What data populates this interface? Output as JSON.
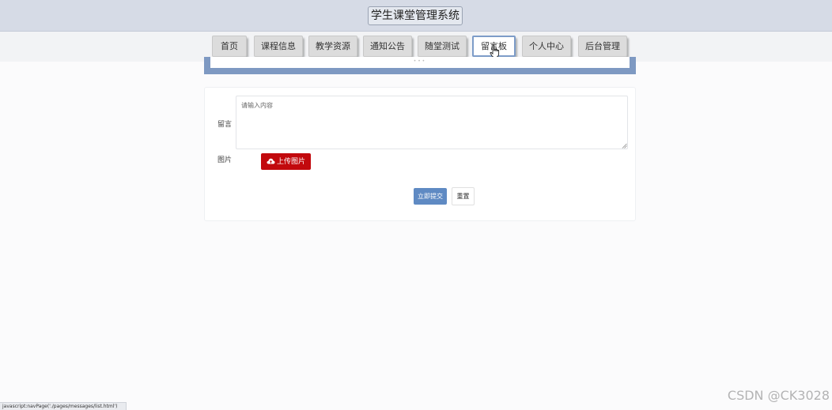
{
  "header": {
    "site_title": "学生课堂管理系统"
  },
  "nav": {
    "items": [
      {
        "label": "首页"
      },
      {
        "label": "课程信息"
      },
      {
        "label": "教学资源"
      },
      {
        "label": "通知公告"
      },
      {
        "label": "随堂测试"
      },
      {
        "label": "留言板",
        "active": true
      },
      {
        "label": "个人中心"
      },
      {
        "label": "后台管理"
      }
    ]
  },
  "form": {
    "message_label": "留言",
    "message_placeholder": "请输入内容",
    "image_label": "图片",
    "upload_button_label": "上传图片",
    "submit_button_label": "立即提交",
    "reset_button_label": "重置"
  },
  "status_bar": {
    "text": "javascript:navPage('./pages/messages/list.html')"
  },
  "watermark": {
    "text": "CSDN @CK3028"
  },
  "colors": {
    "header_bg": "#d6dbe6",
    "active_nav_border": "#7d9cc8",
    "upload_button": "#c2090d",
    "submit_button": "#5f8ac3",
    "banner_frame": "#7e99c2"
  },
  "icons": {
    "upload": "cloud-upload-icon",
    "cursor": "hand-pointer-icon"
  }
}
